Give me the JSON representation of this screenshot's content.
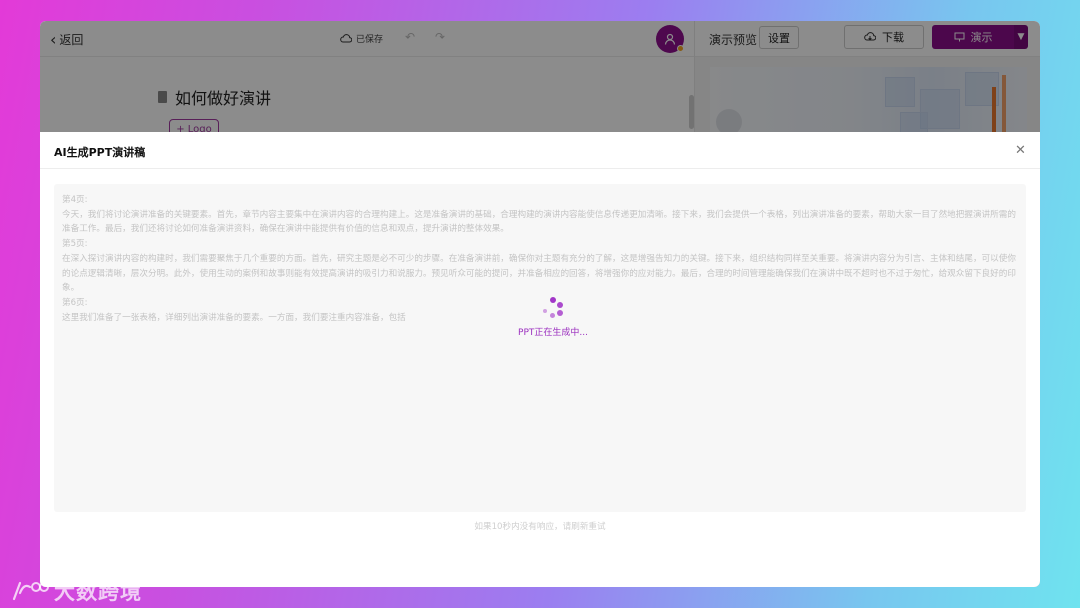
{
  "topbar": {
    "back_label": "返回",
    "save_status": "已保存",
    "undo_icon": "undo-icon",
    "redo_icon": "redo-icon"
  },
  "right_header": {
    "preview_label": "演示预览",
    "settings_label": "设置",
    "download_label": "下载",
    "present_label": "演示"
  },
  "editor": {
    "doc_title": "如何做好演讲",
    "logo_button": "+ Logo"
  },
  "modal": {
    "title": "AI生成PPT演讲稿",
    "close_icon": "close-icon",
    "script_lines": [
      "第4页:",
      "今天，我们将讨论演讲准备的关键要素。首先，章节内容主要集中在演讲内容的合理构建上。这是准备演讲的基础，合理构建的演讲内容能使信息传递更加清晰。接下来，我们会提供一个表格，列出演讲准备的要素，帮助大家一目了然地把握演讲所需的准备工作。最后，我们还将讨论如何准备演讲资料，确保在演讲中能提供有价值的信息和观点，提升演讲的整体效果。",
      "第5页:",
      "在深入探讨演讲内容的构建时，我们需要聚焦于几个重要的方面。首先，研究主题是必不可少的步骤。在准备演讲前，确保你对主题有充分的了解，这是增强告知力的关键。接下来，组织结构同样至关重要。将演讲内容分为引言、主体和结尾，可以使你的论点逻辑清晰，层次分明。此外，使用生动的案例和故事则能有效提高演讲的吸引力和说服力。预见听众可能的提问，并准备相应的回答，将增强你的应对能力。最后，合理的时间管理能确保我们在演讲中既不超时也不过于匆忙，给观众留下良好的印象。",
      "第6页:",
      "这里我们准备了一张表格，详细列出演讲准备的要素。一方面，我们要注重内容准备，包括"
    ],
    "loading_text": "PPT正在生成中...",
    "hint": "如果10秒内没有响应，请刷新重试"
  },
  "watermark": {
    "text": "大数跨境"
  },
  "colors": {
    "brand": "#8b0d8b",
    "spinner": "#a237c8"
  }
}
